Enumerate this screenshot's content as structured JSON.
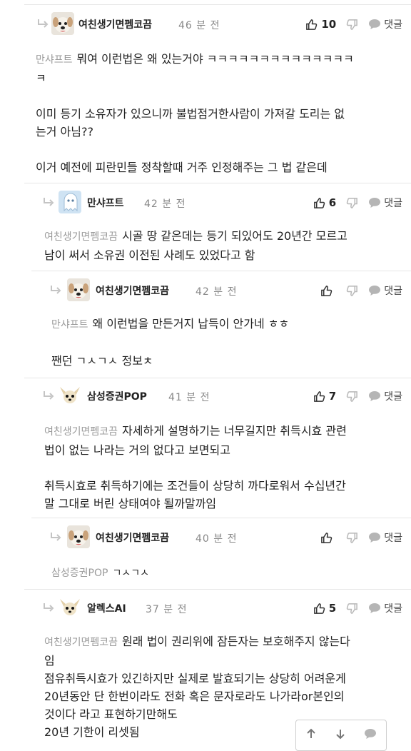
{
  "ui": {
    "reply_label": "댓글"
  },
  "comments": [
    {
      "nick": "여친생기면펨코끔",
      "time": "46 분 전",
      "likes": "10",
      "avatar": "dog-white-icon",
      "mention": "만샤프트",
      "text_first": "뭐여 이런법은 왜 있는거야 ㅋㅋㅋㅋㅋㅋㅋㅋㅋㅋㅋㅋㅋㅋ",
      "lines": [
        "ㅋ",
        "",
        "이미 등기 소유자가 있으니까 불법점거한사람이 가져갈 도리는 없",
        "는거 아님??",
        "",
        "이거 예전에 피란민들 정착할때 거주 인정해주는 그 법 같은데"
      ]
    },
    {
      "nick": "만샤프트",
      "time": "42 분 전",
      "likes": "6",
      "avatar": "ghost-icon",
      "mention": "여친생기면펨코끔",
      "text_first": "시골 땅 같은데는 등기 되있어도 20년간 모르고",
      "lines": [
        "남이 써서 소유권 이전된 사례도 있었다고 함"
      ]
    },
    {
      "nick": "여친생기면펨코끔",
      "time": "42 분 전",
      "likes": "",
      "avatar": "dog-white-icon",
      "mention": "만샤프트",
      "text_first": "왜 이런법을 만든거지 납득이 안가네 ㅎㅎ",
      "lines": [
        "",
        "짼던 ㄱㅅㄱㅅ 정보ㅊ"
      ]
    },
    {
      "nick": "삼성증권POP",
      "time": "41 분 전",
      "likes": "7",
      "avatar": "chihuahua-icon",
      "mention": "여친생기면펨코끔",
      "text_first": "자세하게 설명하기는 너무길지만 취득시효 관련",
      "lines": [
        "법이 없는 나라는 거의 없다고 보면되고",
        "",
        "취득시효로 취득하기에는 조건들이 상당히 까다로워서 수십년간",
        "말 그대로 버린 상태여야 될까말까임"
      ]
    },
    {
      "nick": "여친생기면펨코끔",
      "time": "40 분 전",
      "likes": "",
      "avatar": "dog-white-icon",
      "mention": "삼성증권POP",
      "text_first": "ㄱㅅㄱㅅ",
      "lines": []
    },
    {
      "nick": "알렉스AI",
      "time": "37 분 전",
      "likes": "5",
      "avatar": "chihuahua-icon",
      "mention": "여친생기면펨코끔",
      "text_first": "원래 법이 권리위에 잠든자는 보호해주지 않는다",
      "lines": [
        "임",
        "점유취득시효가 있긴하지만 실제로 발효되기는 상당히 어려운게",
        "20년동안 단 한번이라도 전화 혹은 문자로라도 나가라or본인의",
        "것이다 라고 표현하기만해도",
        "20년 기한이 리셋됨"
      ]
    }
  ],
  "float_bar": {
    "icons": [
      "arrow-up-icon",
      "arrow-down-icon",
      "comment-icon"
    ]
  }
}
